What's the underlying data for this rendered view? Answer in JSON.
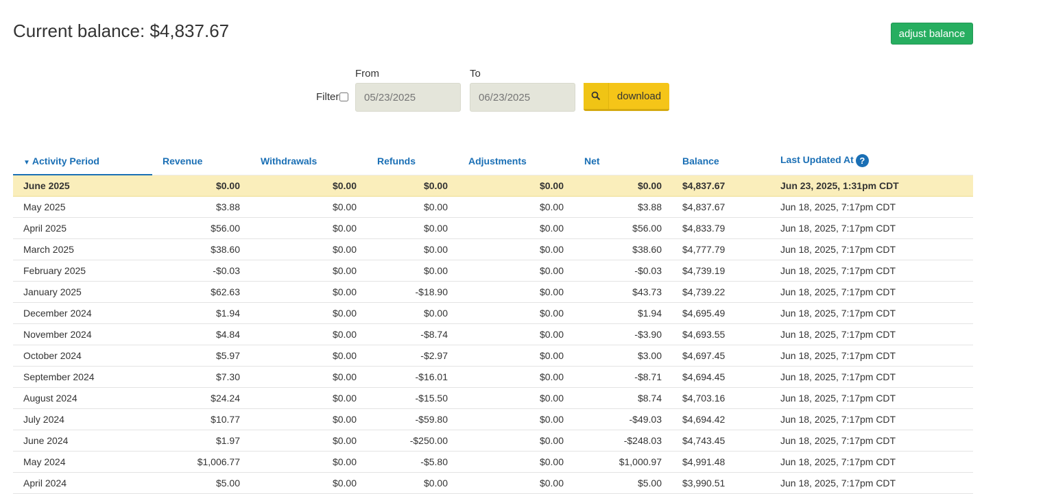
{
  "header": {
    "title": "Current balance: $4,837.67",
    "adjust_label": "adjust balance"
  },
  "filter": {
    "filter_label": "Filter",
    "from_label": "From",
    "to_label": "To",
    "from_placeholder": "05/23/2025",
    "to_placeholder": "06/23/2025",
    "download_label": "download"
  },
  "table": {
    "columns": {
      "period": "Activity Period",
      "revenue": "Revenue",
      "withdrawals": "Withdrawals",
      "refunds": "Refunds",
      "adjustments": "Adjustments",
      "net": "Net",
      "balance": "Balance",
      "updated": "Last Updated At",
      "help": "?"
    },
    "rows": [
      {
        "period": "June 2025",
        "revenue": "$0.00",
        "withdrawals": "$0.00",
        "refunds": "$0.00",
        "adjustments": "$0.00",
        "net": "$0.00",
        "balance": "$4,837.67",
        "updated": "Jun 23, 2025, 1:31pm CDT"
      },
      {
        "period": "May 2025",
        "revenue": "$3.88",
        "withdrawals": "$0.00",
        "refunds": "$0.00",
        "adjustments": "$0.00",
        "net": "$3.88",
        "balance": "$4,837.67",
        "updated": "Jun 18, 2025, 7:17pm CDT"
      },
      {
        "period": "April 2025",
        "revenue": "$56.00",
        "withdrawals": "$0.00",
        "refunds": "$0.00",
        "adjustments": "$0.00",
        "net": "$56.00",
        "balance": "$4,833.79",
        "updated": "Jun 18, 2025, 7:17pm CDT"
      },
      {
        "period": "March 2025",
        "revenue": "$38.60",
        "withdrawals": "$0.00",
        "refunds": "$0.00",
        "adjustments": "$0.00",
        "net": "$38.60",
        "balance": "$4,777.79",
        "updated": "Jun 18, 2025, 7:17pm CDT"
      },
      {
        "period": "February 2025",
        "revenue": "-$0.03",
        "withdrawals": "$0.00",
        "refunds": "$0.00",
        "adjustments": "$0.00",
        "net": "-$0.03",
        "balance": "$4,739.19",
        "updated": "Jun 18, 2025, 7:17pm CDT"
      },
      {
        "period": "January 2025",
        "revenue": "$62.63",
        "withdrawals": "$0.00",
        "refunds": "-$18.90",
        "adjustments": "$0.00",
        "net": "$43.73",
        "balance": "$4,739.22",
        "updated": "Jun 18, 2025, 7:17pm CDT"
      },
      {
        "period": "December 2024",
        "revenue": "$1.94",
        "withdrawals": "$0.00",
        "refunds": "$0.00",
        "adjustments": "$0.00",
        "net": "$1.94",
        "balance": "$4,695.49",
        "updated": "Jun 18, 2025, 7:17pm CDT"
      },
      {
        "period": "November 2024",
        "revenue": "$4.84",
        "withdrawals": "$0.00",
        "refunds": "-$8.74",
        "adjustments": "$0.00",
        "net": "-$3.90",
        "balance": "$4,693.55",
        "updated": "Jun 18, 2025, 7:17pm CDT"
      },
      {
        "period": "October 2024",
        "revenue": "$5.97",
        "withdrawals": "$0.00",
        "refunds": "-$2.97",
        "adjustments": "$0.00",
        "net": "$3.00",
        "balance": "$4,697.45",
        "updated": "Jun 18, 2025, 7:17pm CDT"
      },
      {
        "period": "September 2024",
        "revenue": "$7.30",
        "withdrawals": "$0.00",
        "refunds": "-$16.01",
        "adjustments": "$0.00",
        "net": "-$8.71",
        "balance": "$4,694.45",
        "updated": "Jun 18, 2025, 7:17pm CDT"
      },
      {
        "period": "August 2024",
        "revenue": "$24.24",
        "withdrawals": "$0.00",
        "refunds": "-$15.50",
        "adjustments": "$0.00",
        "net": "$8.74",
        "balance": "$4,703.16",
        "updated": "Jun 18, 2025, 7:17pm CDT"
      },
      {
        "period": "July 2024",
        "revenue": "$10.77",
        "withdrawals": "$0.00",
        "refunds": "-$59.80",
        "adjustments": "$0.00",
        "net": "-$49.03",
        "balance": "$4,694.42",
        "updated": "Jun 18, 2025, 7:17pm CDT"
      },
      {
        "period": "June 2024",
        "revenue": "$1.97",
        "withdrawals": "$0.00",
        "refunds": "-$250.00",
        "adjustments": "$0.00",
        "net": "-$248.03",
        "balance": "$4,743.45",
        "updated": "Jun 18, 2025, 7:17pm CDT"
      },
      {
        "period": "May 2024",
        "revenue": "$1,006.77",
        "withdrawals": "$0.00",
        "refunds": "-$5.80",
        "adjustments": "$0.00",
        "net": "$1,000.97",
        "balance": "$4,991.48",
        "updated": "Jun 18, 2025, 7:17pm CDT"
      },
      {
        "period": "April 2024",
        "revenue": "$5.00",
        "withdrawals": "$0.00",
        "refunds": "$0.00",
        "adjustments": "$0.00",
        "net": "$5.00",
        "balance": "$3,990.51",
        "updated": "Jun 18, 2025, 7:17pm CDT"
      }
    ]
  },
  "colors": {
    "link": "#1a6fb5",
    "negative": "#c0542b",
    "highlight_row": "#faeebb",
    "adjust_button": "#27ae60",
    "download_button": "#f5c518"
  },
  "icons": {
    "download_icon": "search-icon",
    "sort_icon": "chevron-down-icon",
    "help_icon": "question-circle-icon"
  }
}
